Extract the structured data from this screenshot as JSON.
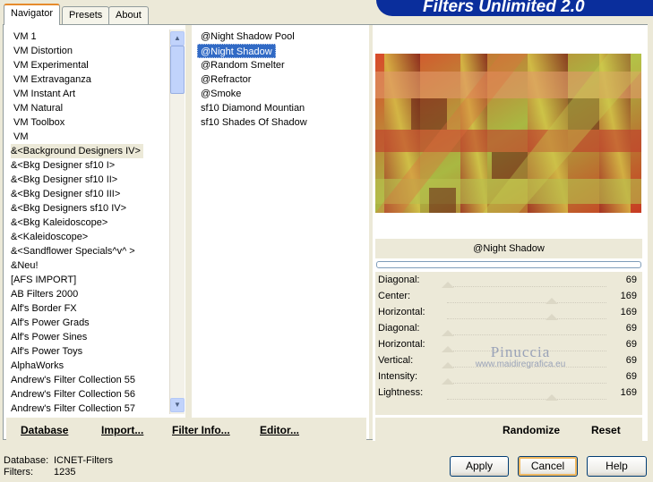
{
  "tabs": [
    "Navigator",
    "Presets",
    "About"
  ],
  "brand": "Filters Unlimited 2.0",
  "categories": [
    "VM 1",
    "VM Distortion",
    "VM Experimental",
    "VM Extravaganza",
    "VM Instant Art",
    "VM Natural",
    "VM Toolbox",
    "VM",
    "&<Background Designers IV>",
    "&<Bkg Designer sf10 I>",
    "&<Bkg Designer sf10 II>",
    "&<Bkg Designer sf10 III>",
    "&<Bkg Designers sf10 IV>",
    "&<Bkg Kaleidoscope>",
    "&<Kaleidoscope>",
    "&<Sandflower Specials^v^ >",
    "&Neu!",
    "[AFS IMPORT]",
    "AB Filters 2000",
    "Alf's Border FX",
    "Alf's Power Grads",
    "Alf's Power Sines",
    "Alf's Power Toys",
    "AlphaWorks",
    "Andrew's Filter Collection 55",
    "Andrew's Filter Collection 56",
    "Andrew's Filter Collection 57"
  ],
  "filters": [
    "@Night Shadow Pool",
    "@Night Shadow",
    "@Random Smelter",
    "@Refractor",
    "@Smoke",
    "sf10 Diamond Mountian",
    "sf10 Shades Of Shadow"
  ],
  "selected_filter_name": "@Night Shadow",
  "params": [
    {
      "label": "Diagonal:",
      "value": "69"
    },
    {
      "label": "Center:",
      "value": "169"
    },
    {
      "label": "Horizontal:",
      "value": "169"
    },
    {
      "label": "Diagonal:",
      "value": "69"
    },
    {
      "label": "Horizontal:",
      "value": "69"
    },
    {
      "label": "Vertical:",
      "value": "69"
    },
    {
      "label": "Intensity:",
      "value": "69"
    },
    {
      "label": "Lightness:",
      "value": "169"
    }
  ],
  "left_buttons": {
    "database": "Database",
    "import": "Import...",
    "filter_info": "Filter Info...",
    "editor": "Editor..."
  },
  "right_buttons": {
    "randomize": "Randomize",
    "reset": "Reset"
  },
  "watermark": {
    "line1": "Pinuccia",
    "line2": "www.maidiregrafica.eu"
  },
  "status": {
    "database_label": "Database:",
    "database_value": "ICNET-Filters",
    "filters_label": "Filters:",
    "filters_value": "1235"
  },
  "dialog_buttons": {
    "apply": "Apply",
    "cancel": "Cancel",
    "help": "Help"
  }
}
